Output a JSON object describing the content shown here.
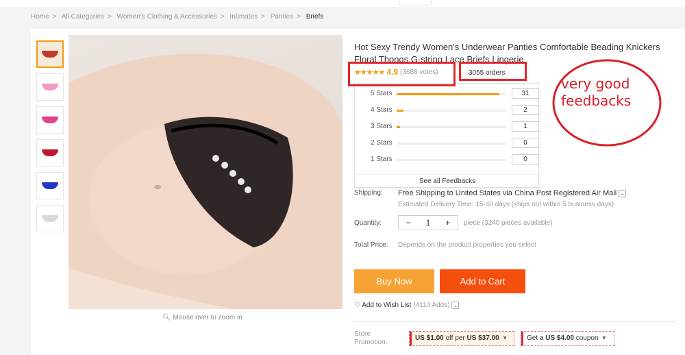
{
  "breadcrumb": [
    "Home",
    "All Categories",
    "Women's Clothing & Accessories",
    "Intimates",
    "Panties",
    "Briefs"
  ],
  "gallery": {
    "thumbnails": [
      {
        "name": "thumb-1",
        "color": "#c0392b"
      },
      {
        "name": "thumb-2",
        "color": "#f29ac4"
      },
      {
        "name": "thumb-3",
        "color": "#e0438a"
      },
      {
        "name": "thumb-4",
        "color": "#c0182e"
      },
      {
        "name": "thumb-5",
        "color": "#2235c9"
      },
      {
        "name": "thumb-6",
        "color": "#d9d9de"
      }
    ],
    "zoom_hint": "Mouse over to zoom in"
  },
  "product": {
    "title": "Hot Sexy Trendy Women's Underwear Panties Comfortable Beading Knickers Floral Thongs G-string Lace Briefs Lingerie",
    "rating": "4.9",
    "votes": "(3688 votes)",
    "orders": "3055 orders"
  },
  "annotation": "very good feedbacks",
  "feedback_popup": {
    "rows": [
      {
        "label": "5 Stars",
        "count": "31",
        "fraction": 0.94
      },
      {
        "label": "4 Stars",
        "count": "2",
        "fraction": 0.06
      },
      {
        "label": "3 Stars",
        "count": "1",
        "fraction": 0.03
      },
      {
        "label": "2 Stars",
        "count": "0",
        "fraction": 0
      },
      {
        "label": "1 Stars",
        "count": "0",
        "fraction": 0
      }
    ],
    "see_all": "See all Feedbacks"
  },
  "shipping": {
    "label": "Shipping:",
    "value": "Free Shipping to United States via China Post Registered Air Mail",
    "delivery": "Estimated Delivery Time: 15-40 days (ships out within 5 business days)"
  },
  "quantity": {
    "label": "Quantity:",
    "minus": "−",
    "value": "1",
    "plus": "+",
    "available": "piece (3240 pieces available)"
  },
  "total": {
    "label": "Total Price:",
    "value": "Depends on the product properties you select"
  },
  "buttons": {
    "buy_now": "Buy Now",
    "add_to_cart": "Add to Cart"
  },
  "wishlist": {
    "label": "Add to Wish List",
    "adds": "(4114 Adds)"
  },
  "promotion": {
    "label_line1": "Store",
    "label_line2": "Promotion:",
    "coupon1_prefix": "US $1.00",
    "coupon1_mid": " off per ",
    "coupon1_suffix": "US $37.00",
    "coupon2_prefix": "Get a ",
    "coupon2_value": "US $4.00",
    "coupon2_suffix": " coupon"
  },
  "colors": {
    "accent": "#f39c12",
    "buy_now": "#f7a234",
    "add_to_cart": "#f54f0e",
    "annotation": "#d8202a"
  }
}
